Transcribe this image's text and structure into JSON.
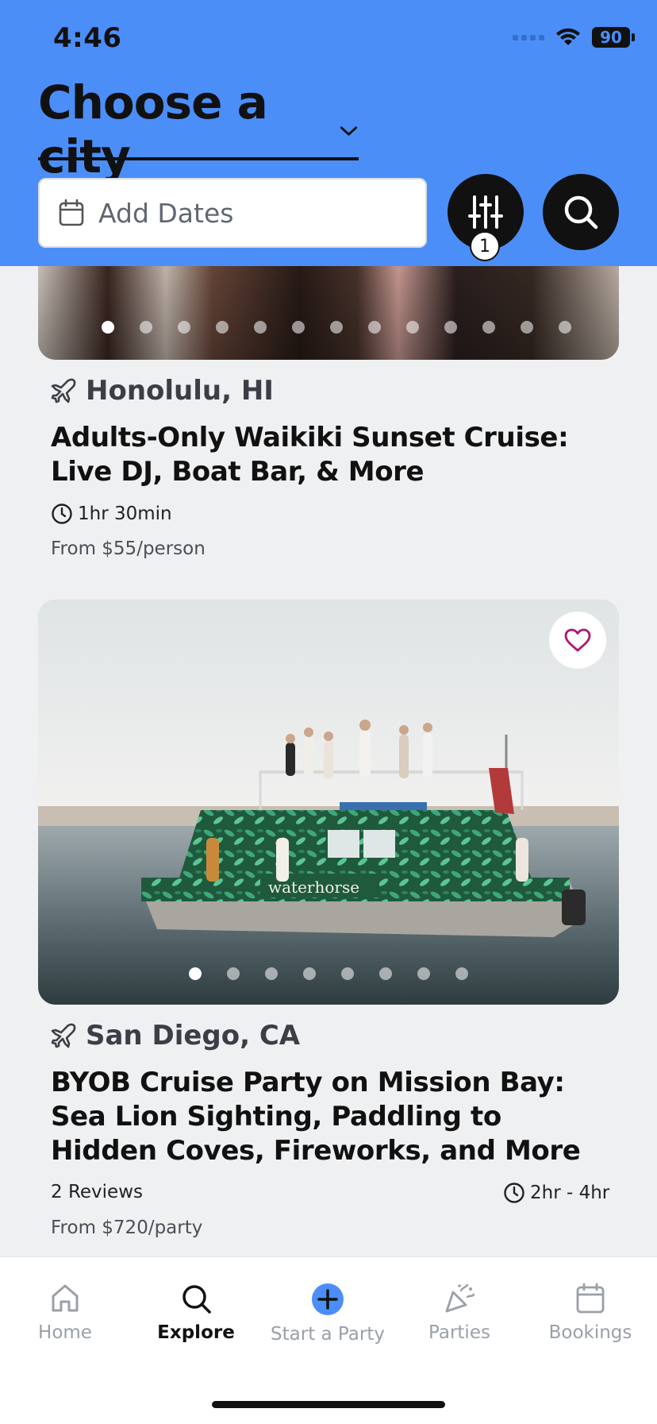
{
  "status": {
    "time": "4:46",
    "battery": "90"
  },
  "header": {
    "city_title": "Choose a city",
    "dates_placeholder": "Add Dates",
    "filter_count": "1"
  },
  "listings": [
    {
      "location": "Honolulu, HI",
      "title": "Adults-Only Waikiki Sunset Cruise: Live DJ, Boat Bar, & More",
      "duration": "1hr 30min",
      "price": "From $55/person",
      "image_dots": 13,
      "active_dot": 0
    },
    {
      "location": "San Diego, CA",
      "title": "BYOB Cruise Party on Mission Bay: Sea Lion Sighting, Paddling to Hidden Coves, Fireworks, and More",
      "reviews": "2 Reviews",
      "duration": "2hr - 4hr",
      "price": "From $720/party",
      "image_dots": 8,
      "active_dot": 0,
      "boat_sign": "waterhorse"
    }
  ],
  "tabs": [
    {
      "label": "Home",
      "icon": "home-icon",
      "active": false
    },
    {
      "label": "Explore",
      "icon": "search-icon",
      "active": true
    },
    {
      "label": "Start a Party",
      "icon": "plus-circle-icon",
      "active": false
    },
    {
      "label": "Parties",
      "icon": "party-popper-icon",
      "active": false
    },
    {
      "label": "Bookings",
      "icon": "calendar-icon",
      "active": false
    }
  ],
  "colors": {
    "header_bg": "#4b8ef8",
    "accent": "#4b8ef8",
    "heart": "#b0166b"
  }
}
